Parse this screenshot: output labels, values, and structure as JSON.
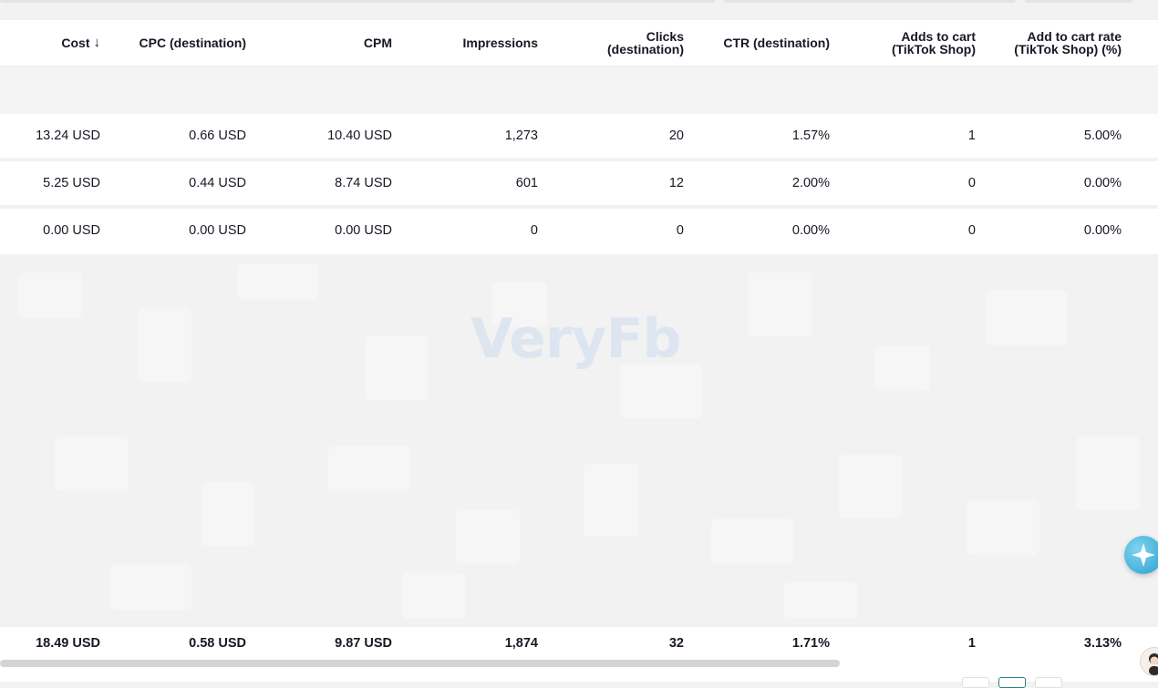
{
  "columns": [
    {
      "id": "cost",
      "label": "Cost",
      "sort_glyph": "↓"
    },
    {
      "id": "cpc",
      "label": "CPC (destination)"
    },
    {
      "id": "cpm",
      "label": "CPM"
    },
    {
      "id": "impressions",
      "label": "Impressions"
    },
    {
      "id": "clicks",
      "label": "Clicks (destination)"
    },
    {
      "id": "ctr",
      "label": "CTR (destination)"
    },
    {
      "id": "atc",
      "label": "Adds to cart (TikTok Shop)"
    },
    {
      "id": "atc_rate",
      "label": "Add to cart rate (TikTok Shop) (%)"
    }
  ],
  "rows": [
    [
      "13.24 USD",
      "0.66 USD",
      "10.40 USD",
      "1,273",
      "20",
      "1.57%",
      "1",
      "5.00%"
    ],
    [
      "5.25 USD",
      "0.44 USD",
      "8.74 USD",
      "601",
      "12",
      "2.00%",
      "0",
      "0.00%"
    ],
    [
      "0.00 USD",
      "0.00 USD",
      "0.00 USD",
      "0",
      "0",
      "0.00%",
      "0",
      "0.00%"
    ]
  ],
  "totals": [
    "18.49 USD",
    "0.58 USD",
    "9.87 USD",
    "1,874",
    "32",
    "1.71%",
    "1",
    "3.13%"
  ],
  "watermark": "VeryFb",
  "icons": {
    "fab": "sparkle-star-icon",
    "avatar": "user-avatar-icon"
  }
}
